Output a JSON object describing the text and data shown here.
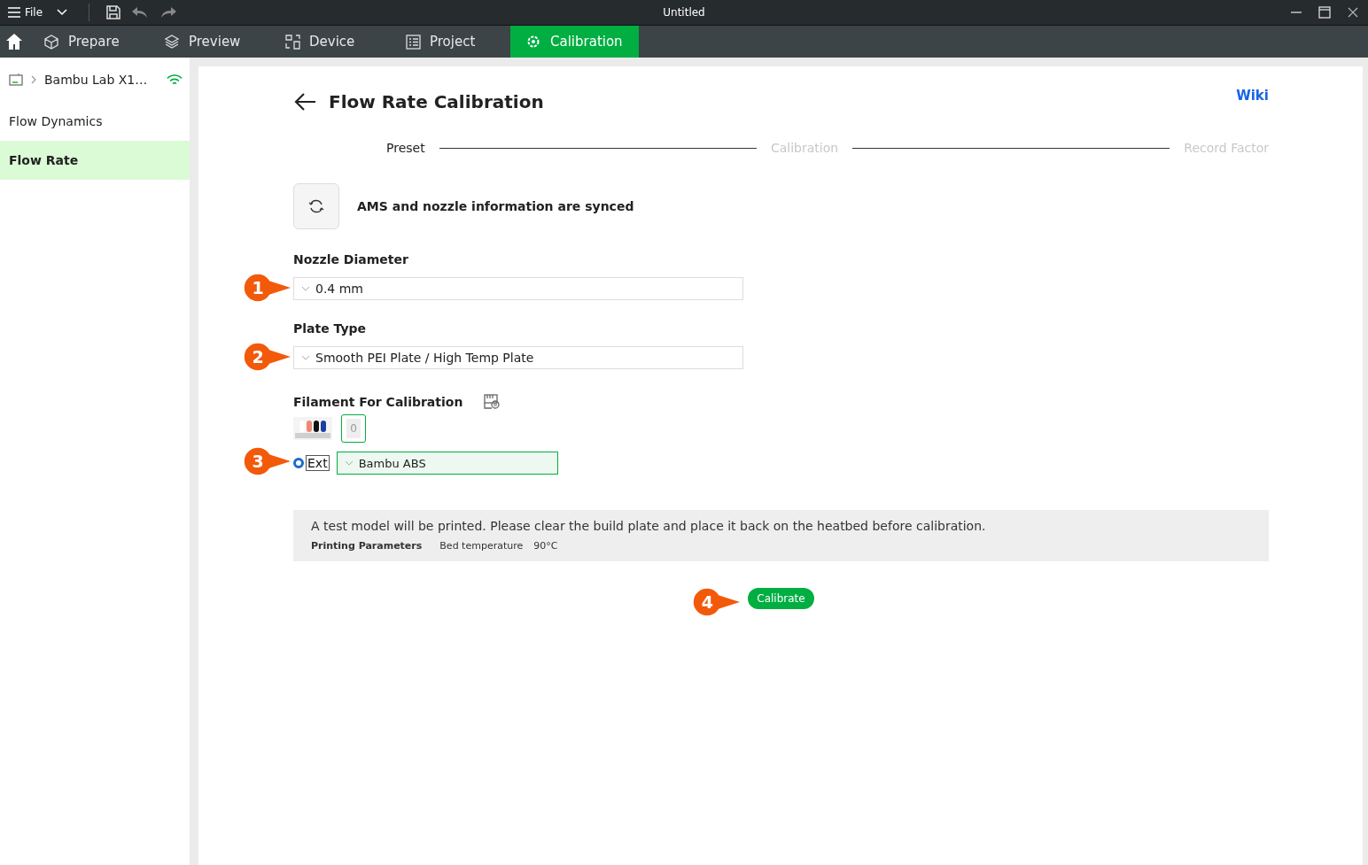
{
  "window": {
    "title": "Untitled",
    "menu_label": "File"
  },
  "tabs": [
    {
      "label": "Prepare",
      "kind": "cube",
      "selected": false
    },
    {
      "label": "Preview",
      "kind": "layers",
      "selected": false
    },
    {
      "label": "Device",
      "kind": "device",
      "selected": false
    },
    {
      "label": "Project",
      "kind": "list",
      "selected": false
    },
    {
      "label": "Calibration",
      "kind": "gear",
      "selected": true
    }
  ],
  "sidebar": {
    "printer": "Bambu Lab X1…",
    "items": [
      {
        "label": "Flow Dynamics",
        "selected": false
      },
      {
        "label": "Flow Rate",
        "selected": true
      }
    ]
  },
  "page": {
    "title": "Flow Rate Calibration",
    "wiki": "Wiki",
    "steps": [
      {
        "label": "Preset",
        "active": true
      },
      {
        "label": "Calibration",
        "active": false
      },
      {
        "label": "Record Factor",
        "active": false
      }
    ],
    "sync_message": "AMS and nozzle information are synced",
    "fields": [
      {
        "label": "Nozzle Diameter",
        "value": "0.4 mm",
        "callout": "1"
      },
      {
        "label": "Plate Type",
        "value": "Smooth PEI Plate / High Temp Plate",
        "callout": "2"
      }
    ],
    "filament": {
      "label": "Filament For Calibration",
      "ams_slots": [
        {
          "color": "#ffffff"
        },
        {
          "color": "#f08878"
        },
        {
          "color": "#111111"
        },
        {
          "color": "#1a3fa0"
        }
      ],
      "slot_label": "0",
      "source": {
        "label": "Ext",
        "selected": true
      },
      "value": "Bambu ABS",
      "callout": "3"
    },
    "notice": {
      "text": "A test model will be printed. Please clear the build plate and place it back on the heatbed before calibration.",
      "params_label": "Printing Parameters",
      "param_name": "Bed temperature",
      "param_value": "90°C"
    },
    "calibrate": {
      "label": "Calibrate",
      "callout": "4"
    }
  }
}
